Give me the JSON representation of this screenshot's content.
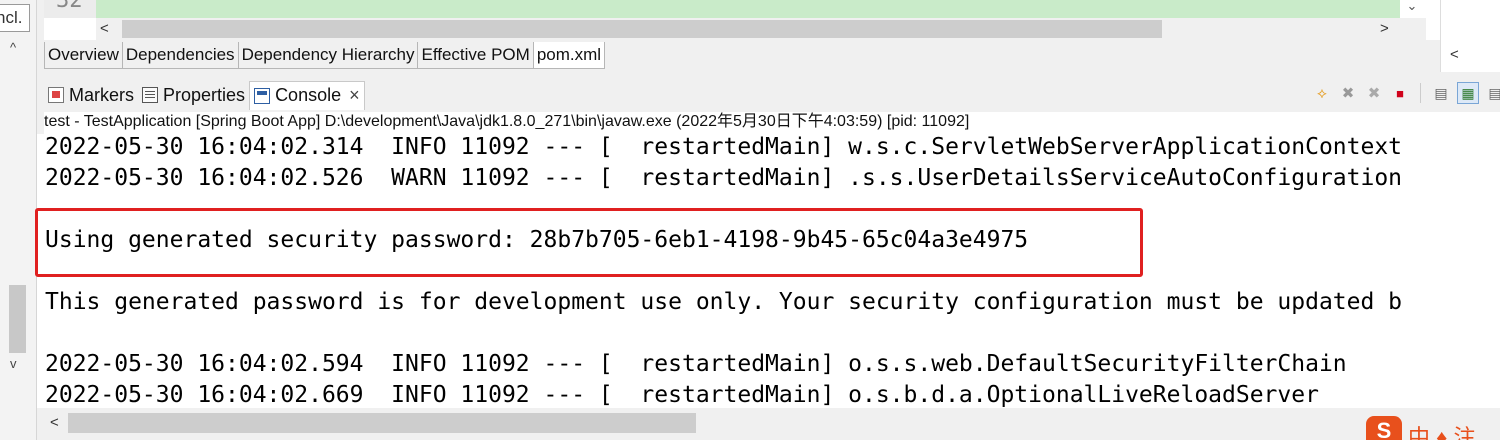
{
  "left_panel": {
    "partial_label": "ncl.",
    "up_arrow": "^",
    "down_arrow": "v"
  },
  "editor": {
    "line_number": "32",
    "scroll_down": "⌄",
    "scroll_left": "<",
    "scroll_right": ">",
    "outline_scroll_left": "<"
  },
  "pom_tabs": [
    {
      "label": "Overview"
    },
    {
      "label": "Dependencies"
    },
    {
      "label": "Dependency Hierarchy"
    },
    {
      "label": "Effective POM"
    },
    {
      "label": "pom.xml"
    }
  ],
  "view_tabs": {
    "markers": "Markers",
    "properties": "Properties",
    "console": "Console",
    "close": "×"
  },
  "toolbar_icons": [
    "pin-icon",
    "remove-launch-icon",
    "remove-all-terminated-icon",
    "terminate-icon",
    "scroll-lock-icon",
    "word-wrap-icon",
    "show-console-icon"
  ],
  "console": {
    "process": "test - TestApplication [Spring Boot App] D:\\development\\Java\\jdk1.8.0_271\\bin\\javaw.exe  (2022年5月30日下午4:03:59) [pid: 11092]",
    "lines": [
      "2022-05-30 16:04:02.314  INFO 11092 --- [  restartedMain] w.s.c.ServletWebServerApplicationContext",
      "2022-05-30 16:04:02.526  WARN 11092 --- [  restartedMain] .s.s.UserDetailsServiceAutoConfiguration",
      "Using generated security password: 28b7b705-6eb1-4198-9b45-65c04a3e4975",
      "This generated password is for development use only. Your security configuration must be updated b",
      "2022-05-30 16:04:02.594  INFO 11092 --- [  restartedMain] o.s.s.web.DefaultSecurityFilterChain",
      "2022-05-30 16:04:02.669  INFO 11092 --- [  restartedMain] o.s.b.d.a.OptionalLiveReloadServer"
    ],
    "scroll_left": "<"
  },
  "watermark": {
    "logo_letter": "S",
    "text": "中 ♦ 注"
  },
  "colors": {
    "highlight": "#e02020",
    "added_line": "#c9ebc9",
    "watermark": "#e8501c"
  }
}
